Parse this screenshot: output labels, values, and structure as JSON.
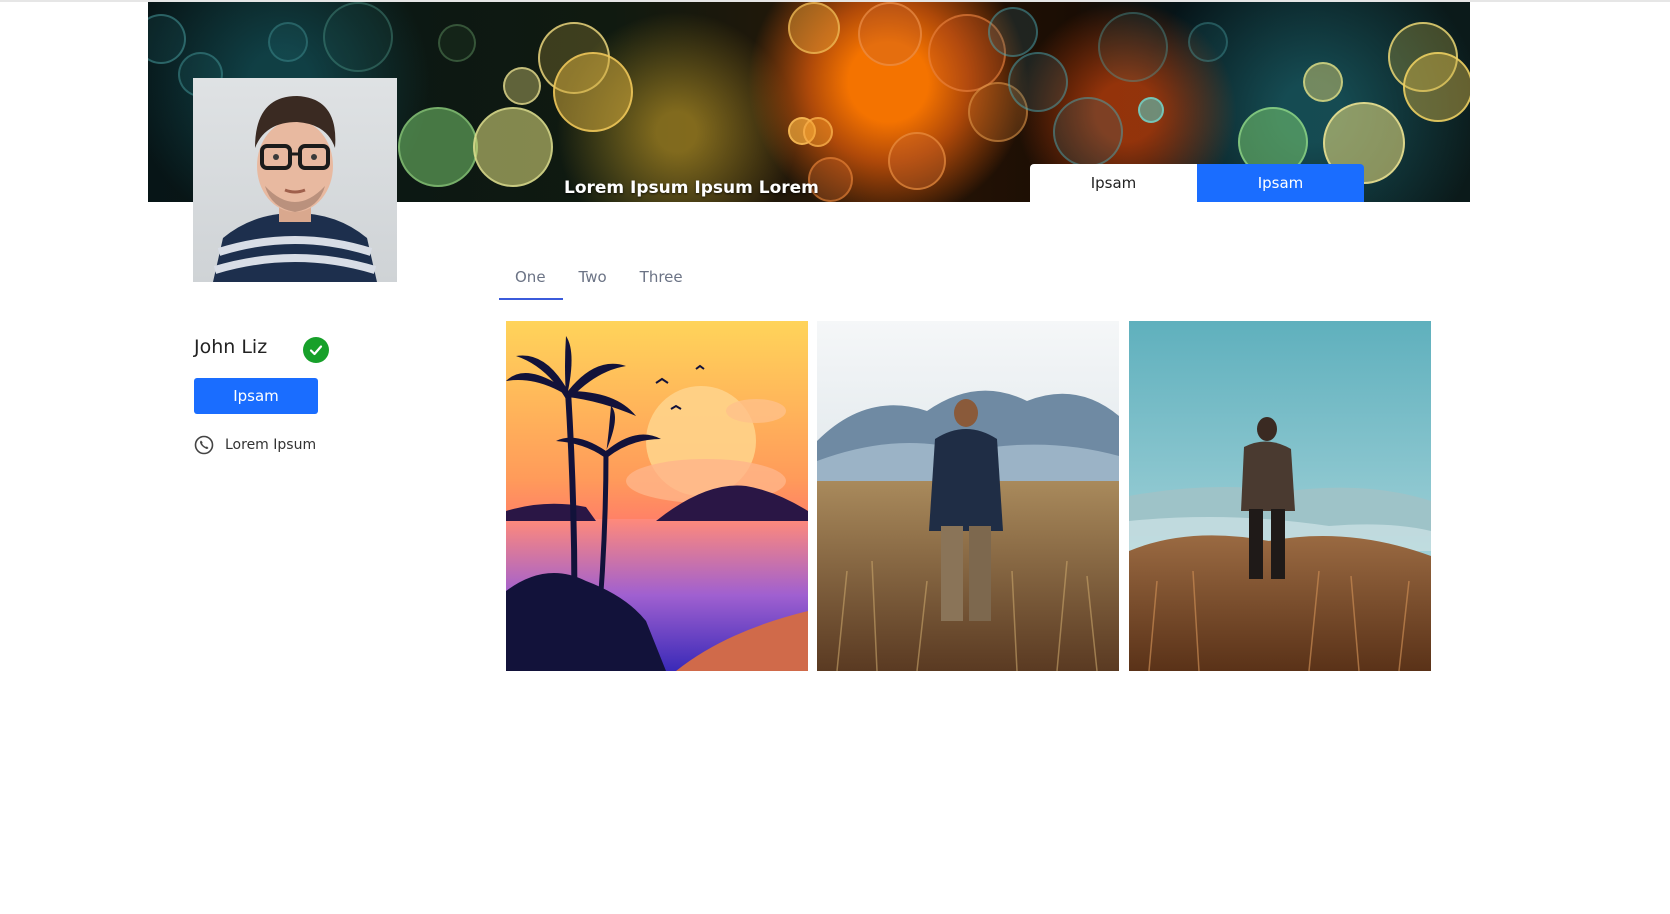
{
  "cover": {
    "title": "Lorem Ipsum Ipsum Lorem",
    "tabs": [
      {
        "label": "Ipsam",
        "style": "light"
      },
      {
        "label": "Ipsam",
        "style": "primary"
      }
    ]
  },
  "profile": {
    "name": "John Liz",
    "verified": true,
    "button_label": "Ipsam",
    "contact_label": "Lorem Ipsum"
  },
  "tabs": [
    {
      "label": "One",
      "active": true
    },
    {
      "label": "Two",
      "active": false
    },
    {
      "label": "Three",
      "active": false
    }
  ],
  "gallery": [
    {
      "name": "sunset-palms-illustration"
    },
    {
      "name": "man-in-field-mountains-photo"
    },
    {
      "name": "man-on-hill-valley-photo"
    }
  ],
  "colors": {
    "primary": "#1a6dff",
    "verified": "#17a02a",
    "tab_text": "#6b7385",
    "tab_underline": "#3b5bdb"
  }
}
